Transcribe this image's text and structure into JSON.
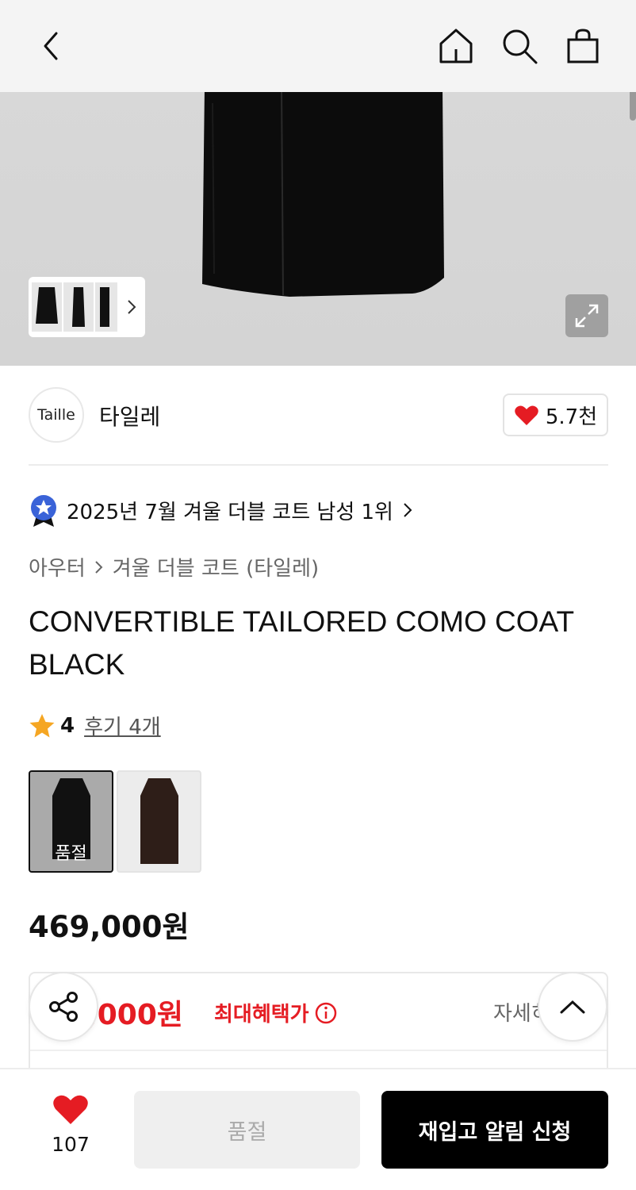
{
  "header": {
    "back_icon": "chevron-left-icon",
    "home_icon": "home-icon",
    "search_icon": "search-icon",
    "cart_icon": "shopping-bag-icon"
  },
  "gallery": {
    "thumbnail_count": 3,
    "expand_icon": "expand-icon"
  },
  "brand": {
    "logo_text": "Taille",
    "name": "타일레",
    "likes": "5.7천"
  },
  "ranking": {
    "text": "2025년 7월 겨울 더블 코트 남성 1위"
  },
  "breadcrumb": [
    "아우터",
    "겨울 더블 코트 (타일레)"
  ],
  "product": {
    "title": "CONVERTIBLE TAILORED COMO COAT BLACK",
    "rating": "4",
    "reviews_label": "후기 4개",
    "price": "469,000원"
  },
  "swatches": [
    {
      "color": "#111111",
      "label": "품절",
      "selected": true
    },
    {
      "color": "#2e1e18",
      "label": "",
      "selected": false
    }
  ],
  "benefit": {
    "price": "9,000원",
    "label": "최대혜택가",
    "detail": "자세히"
  },
  "bottom": {
    "favorite_count": "107",
    "soldout_label": "품절",
    "restock_label": "재입고 알림 신청"
  },
  "colors": {
    "accent_red": "#e51c23",
    "star": "#f5a623",
    "rank_badge": "#3a63d8"
  }
}
